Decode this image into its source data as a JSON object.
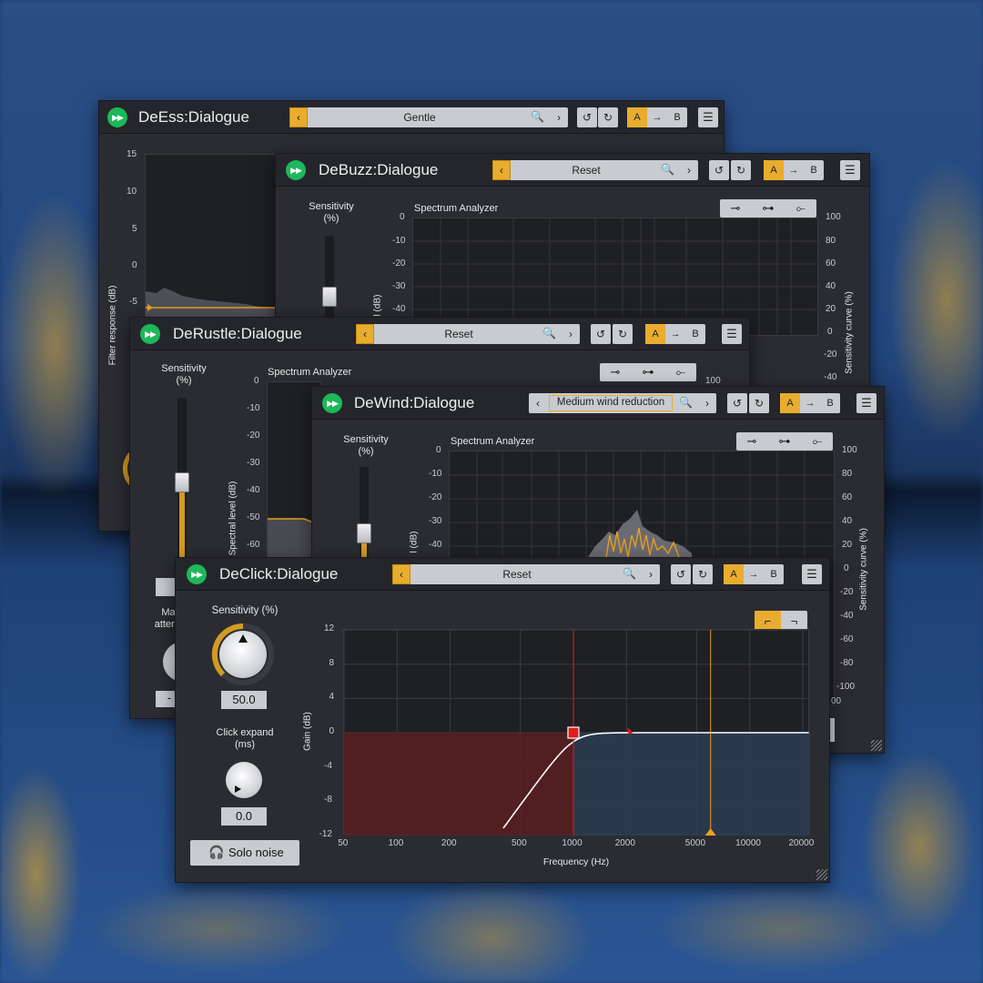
{
  "colors": {
    "accent": "#e8ad2e",
    "panel": "#2b2c32",
    "logo": "#1db85a",
    "gain_curve": "#ffffff",
    "marker_red": "#e11b1b",
    "marker_orange": "#e8a020"
  },
  "deess": {
    "title": "DeEss:Dialogue",
    "preset": "Gentle",
    "y_axis_label": "Filter response (dB)",
    "y_ticks": [
      "15",
      "10",
      "5",
      "0",
      "-5"
    ]
  },
  "debuzz": {
    "title": "DeBuzz:Dialogue",
    "preset": "Reset",
    "sensitivity_label": "Sensitivity\n(%)",
    "analyzer_label": "Spectrum Analyzer",
    "left_ticks": [
      "0",
      "-10",
      "-20",
      "-30",
      "-40"
    ],
    "right_ticks": [
      "100",
      "80",
      "60",
      "40",
      "20",
      "0",
      "-20",
      "-40"
    ],
    "left_axis_label": "l (dB)",
    "right_axis_label": "Sensitivity curve (%)"
  },
  "derustle": {
    "title": "DeRustle:Dialogue",
    "preset": "Reset",
    "sensitivity_label": "Sensitivity\n(%)",
    "analyzer_label": "Spectrum Analyzer",
    "left_ticks": [
      "0",
      "-10",
      "-20",
      "-30",
      "-40",
      "-50",
      "-60"
    ],
    "right_tick": "100",
    "left_axis_label": "Spectral level (dB)",
    "attenuation_label": "Ma\nattenu",
    "partial_value": "-"
  },
  "dewind": {
    "title": "DeWind:Dialogue",
    "preset": "Medium wind reduction",
    "sensitivity_label": "Sensitivity\n(%)",
    "analyzer_label": "Spectrum Analyzer",
    "left_ticks": [
      "0",
      "-10",
      "-20",
      "-30",
      "-40"
    ],
    "right_ticks": [
      "100",
      "80",
      "60",
      "40",
      "20",
      "0",
      "-20",
      "-40",
      "-60",
      "-80",
      "-100"
    ],
    "left_axis_label": "l (dB)",
    "right_axis_label": "Sensitivity curve (%)",
    "partial_freq": "00"
  },
  "declick": {
    "title": "DeClick:Dialogue",
    "preset": "Reset",
    "sensitivity_label": "Sensitivity (%)",
    "sensitivity_value": "50.0",
    "click_expand_label": "Click expand\n(ms)",
    "click_expand_value": "0.0",
    "solo_label": "Solo noise",
    "y_axis_label": "Gain (dB)",
    "x_axis_label": "Frequency (Hz)",
    "y_ticks": [
      "12",
      "8",
      "4",
      "0",
      "-4",
      "-8",
      "-12"
    ],
    "x_ticks": [
      "50",
      "100",
      "200",
      "500",
      "1000",
      "2000",
      "5000",
      "10000",
      "20000"
    ],
    "cutoff_hz": 1000,
    "orange_marker_hz": 6000
  },
  "common": {
    "ab_a": "A",
    "ab_arrow": "→",
    "ab_b": "B",
    "undo": "↺",
    "redo": "↻",
    "menu": "☰",
    "prev": "‹",
    "next": "›",
    "search": "🔍",
    "logo_glyph": "▶▶"
  }
}
